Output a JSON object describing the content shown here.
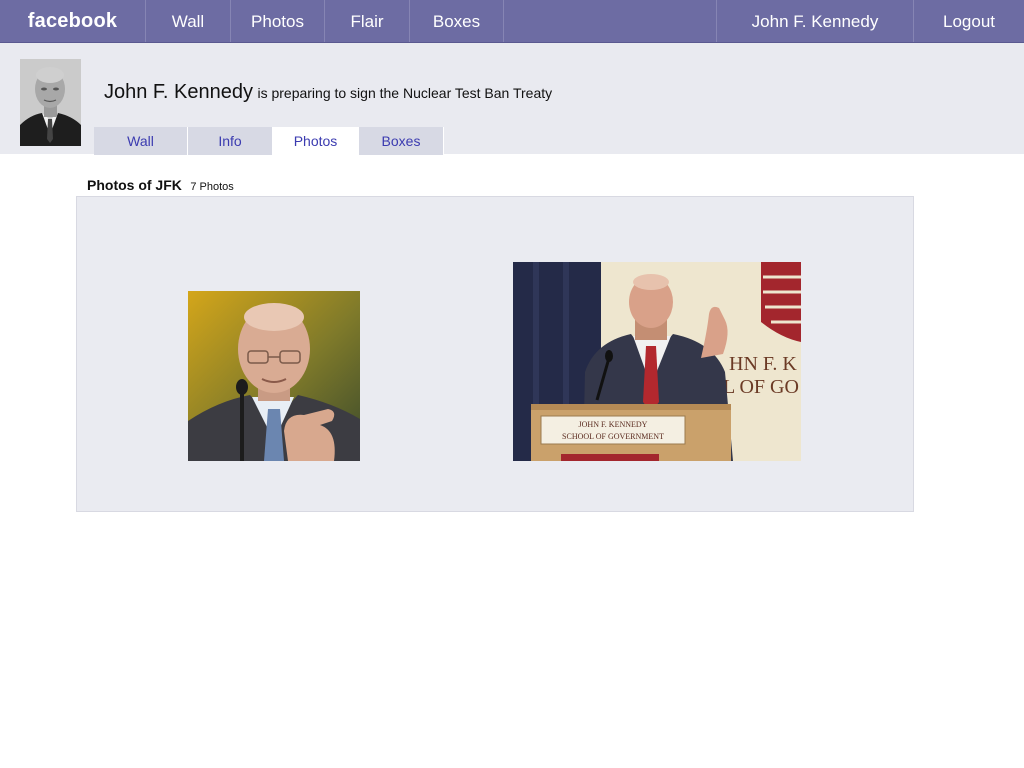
{
  "topnav": {
    "logo": "facebook",
    "items": [
      "Wall",
      "Photos",
      "Flair",
      "Boxes"
    ],
    "user_name": "John F. Kennedy",
    "logout": "Logout"
  },
  "profile": {
    "name": "John F. Kennedy",
    "status": "is preparing to sign the Nuclear Test Ban Treaty"
  },
  "tabs": [
    {
      "label": "Wall",
      "active": false
    },
    {
      "label": "Info",
      "active": false
    },
    {
      "label": "Photos",
      "active": true
    },
    {
      "label": "Boxes",
      "active": false
    }
  ],
  "photos_section": {
    "title": "Photos of JFK",
    "count": "7 Photos"
  },
  "podium": {
    "line1": "JOHN F. KENNEDY",
    "line2": "SCHOOL OF GOVERNMENT"
  },
  "banner_text": {
    "line1": "HN F. K",
    "line2": "L OF GO"
  },
  "colors": {
    "nav_bg": "#6d6ca3",
    "header_bg": "#e9eaf0",
    "tab_bg": "#d7d9e4",
    "link": "#3b3bb0",
    "photo_box_bg": "#eaebf1"
  }
}
